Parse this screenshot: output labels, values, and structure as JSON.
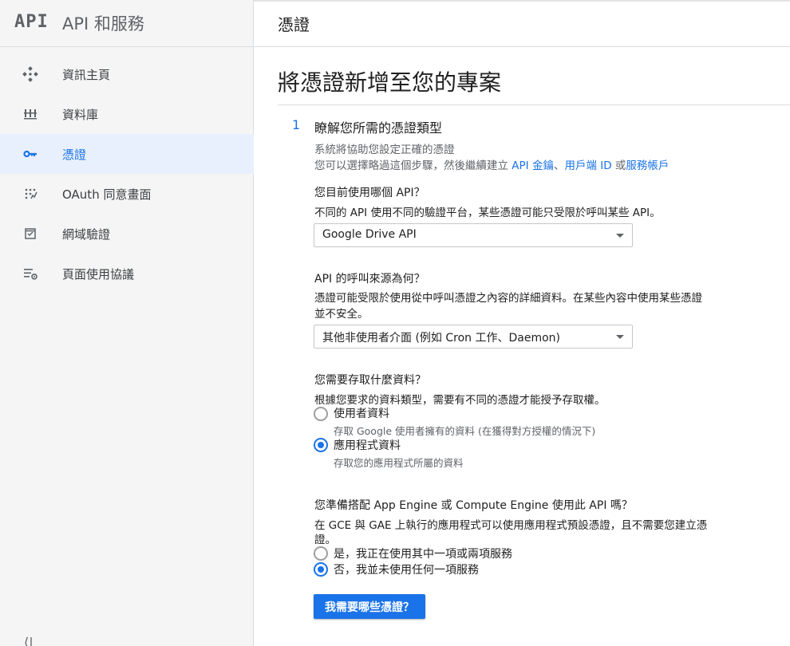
{
  "brand": {
    "logo": "API",
    "title": "API 和服務"
  },
  "header": {
    "title": "憑證"
  },
  "sidebar": {
    "items": [
      {
        "label": "資訊主頁",
        "icon": "dashboard-icon"
      },
      {
        "label": "資料庫",
        "icon": "library-icon"
      },
      {
        "label": "憑證",
        "icon": "key-icon",
        "active": true
      },
      {
        "label": "OAuth 同意畫面",
        "icon": "oauth-consent-icon"
      },
      {
        "label": "網域驗證",
        "icon": "domain-verification-icon"
      },
      {
        "label": "頁面使用協議",
        "icon": "page-usage-agreements-icon"
      }
    ],
    "collapse_glyph": "⟨|"
  },
  "main": {
    "title": "將憑證新增至您的專案",
    "step": {
      "number": "1",
      "title": "瞭解您所需的憑證類型"
    },
    "intro_line1": "系統將協助您設定正確的憑證",
    "intro_line2_prefix": "您可以選擇略過這個步驟，然後繼續建立 ",
    "link_api_key": "API 金鑰",
    "sep1": "、",
    "link_client_id": "用戶端 ID",
    "sep2": " 或",
    "link_service_account": "服務帳戶",
    "q1": {
      "question": "您目前使用哪個 API？",
      "help": "不同的 API 使用不同的驗證平台，某些憑證可能只受限於呼叫某些 API。",
      "selected": "Google Drive API"
    },
    "q2": {
      "question": "API 的呼叫來源為何？",
      "help_line1": "憑證可能受限於使用從中呼叫憑證之內容的詳細資料。在某些內容中使用某些憑證",
      "help_line2": "並不安全。",
      "selected": "其他非使用者介面 (例如 Cron 工作、Daemon)"
    },
    "q3": {
      "question": "您需要存取什麼資料？",
      "help": "根據您要求的資料類型，需要有不同的憑證才能授予存取權。",
      "options": [
        {
          "label": "使用者資料",
          "desc": "存取 Google 使用者擁有的資料 (在獲得對方授權的情況下)",
          "checked": false
        },
        {
          "label": "應用程式資料",
          "desc": "存取您的應用程式所屬的資料",
          "checked": true
        }
      ]
    },
    "q4": {
      "question": "您準備搭配 App Engine 或 Compute Engine 使用此 API 嗎？",
      "help_line1": "在 GCE 與 GAE 上執行的應用程式可以使用應用程式預設憑證，且不需要您建立憑",
      "help_line2": "證。",
      "options": [
        {
          "label": "是，我正在使用其中一項或兩項服務",
          "checked": false
        },
        {
          "label": "否，我並未使用任何一項服務",
          "checked": true
        }
      ]
    },
    "submit_label": "我需要哪些憑證？"
  },
  "colors": {
    "accent": "#1a73e8",
    "sidebar_bg": "#f5f5f5",
    "active_bg": "#e8f0fe"
  }
}
